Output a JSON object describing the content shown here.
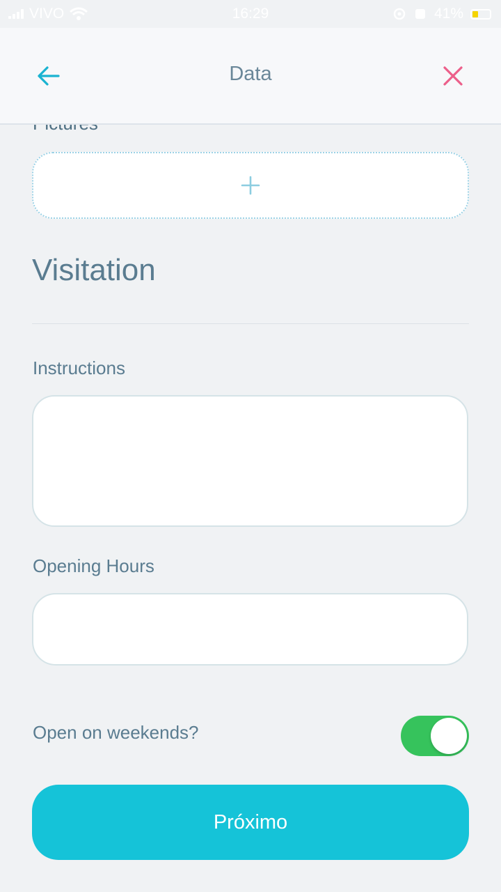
{
  "status_bar": {
    "carrier": "VIVO",
    "time": "16:29",
    "battery_text": "41%",
    "icons": [
      "signal-icon",
      "wifi-icon",
      "alarm-icon",
      "lock-rotation-icon",
      "battery-icon"
    ]
  },
  "header": {
    "title": "Data",
    "back_icon": "arrow-left-icon",
    "close_icon": "close-icon",
    "accent_color": "#1ab3d1",
    "close_color": "#ec5f8a"
  },
  "pictures": {
    "label": "Pictures",
    "add_icon": "plus-icon"
  },
  "visitation": {
    "title": "Visitation",
    "instructions_label": "Instructions",
    "instructions_value": "",
    "opening_hours_label": "Opening Hours",
    "opening_hours_value": "",
    "weekends_label": "Open on weekends?",
    "weekends_on": true
  },
  "footer": {
    "next_label": "Próximo",
    "button_color": "#15c3d8"
  }
}
